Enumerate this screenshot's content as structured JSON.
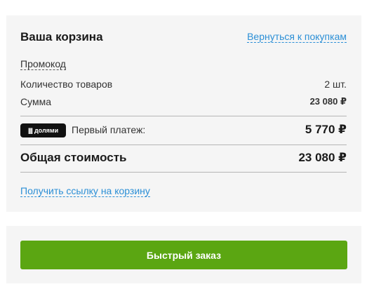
{
  "cart": {
    "title": "Ваша корзина",
    "back_link": "Вернуться к покупкам",
    "promo_label": "Промокод",
    "items_count_label": "Количество товаров",
    "items_count_value": "2 шт.",
    "sum_label": "Сумма",
    "sum_value": "23 080 ₽",
    "installment": {
      "badge_text": "долями",
      "badge_bars": "||||",
      "label": "Первый платеж:",
      "value": "5 770 ₽"
    },
    "total_label": "Общая стоимость",
    "total_value": "23 080 ₽",
    "share_link": "Получить ссылку на корзину"
  },
  "quick_order": {
    "button_label": "Быстрый заказ"
  },
  "colors": {
    "link": "#2b8fd6",
    "button": "#5ba612",
    "panel_bg": "#f5f5f5",
    "badge_bg": "#111111"
  }
}
